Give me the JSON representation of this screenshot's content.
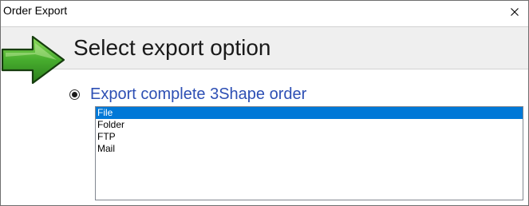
{
  "window": {
    "title": "Order Export",
    "close_icon": "close-icon"
  },
  "header": {
    "title": "Select export option",
    "icon": "green-arrow-icon",
    "arrow_color": "#3fa12c"
  },
  "option": {
    "label": "Export complete 3Shape order",
    "selected": true,
    "label_color": "#2d4fb4"
  },
  "export_list": {
    "selected_index": 0,
    "selected_color": "#0078d7",
    "items": [
      {
        "label": "File"
      },
      {
        "label": "Folder"
      },
      {
        "label": "FTP"
      },
      {
        "label": "Mail"
      }
    ]
  }
}
